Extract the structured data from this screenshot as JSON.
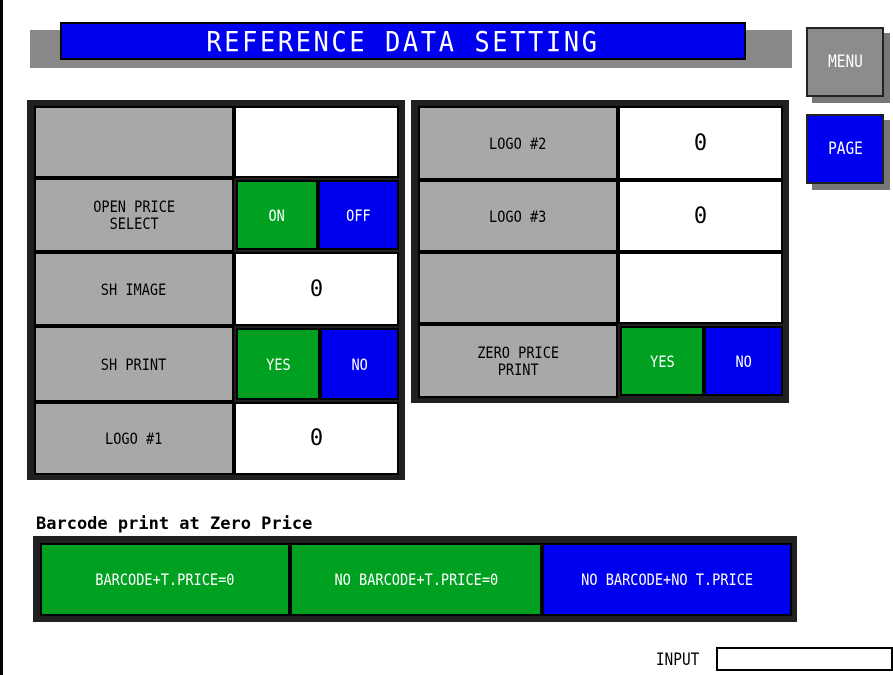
{
  "title": "REFERENCE DATA SETTING",
  "side": {
    "menu": "MENU",
    "page": "PAGE"
  },
  "left_panel": {
    "row1": {
      "label": "",
      "value": ""
    },
    "open_price": {
      "label": "OPEN PRICE\nSELECT",
      "on": "ON",
      "off": "OFF"
    },
    "sh_image": {
      "label": "SH IMAGE",
      "value": "0"
    },
    "sh_print": {
      "label": "SH PRINT",
      "yes": "YES",
      "no": "NO"
    },
    "logo1": {
      "label": "LOGO #1",
      "value": "0"
    }
  },
  "right_panel": {
    "logo2": {
      "label": "LOGO #2",
      "value": "0"
    },
    "logo3": {
      "label": "LOGO #3",
      "value": "0"
    },
    "row3": {
      "label": "",
      "value": ""
    },
    "zero_price_print": {
      "label": "ZERO PRICE\nPRINT",
      "yes": "YES",
      "no": "NO"
    }
  },
  "barcode": {
    "label": "Barcode print at Zero Price",
    "options": [
      "BARCODE+T.PRICE=0",
      "NO BARCODE+T.PRICE=0",
      "NO BARCODE+NO T.PRICE"
    ]
  },
  "input": {
    "label": "INPUT",
    "value": ""
  },
  "colors": {
    "blue": "#0000f0",
    "green": "#00a020",
    "gray": "#a8a8a8"
  }
}
